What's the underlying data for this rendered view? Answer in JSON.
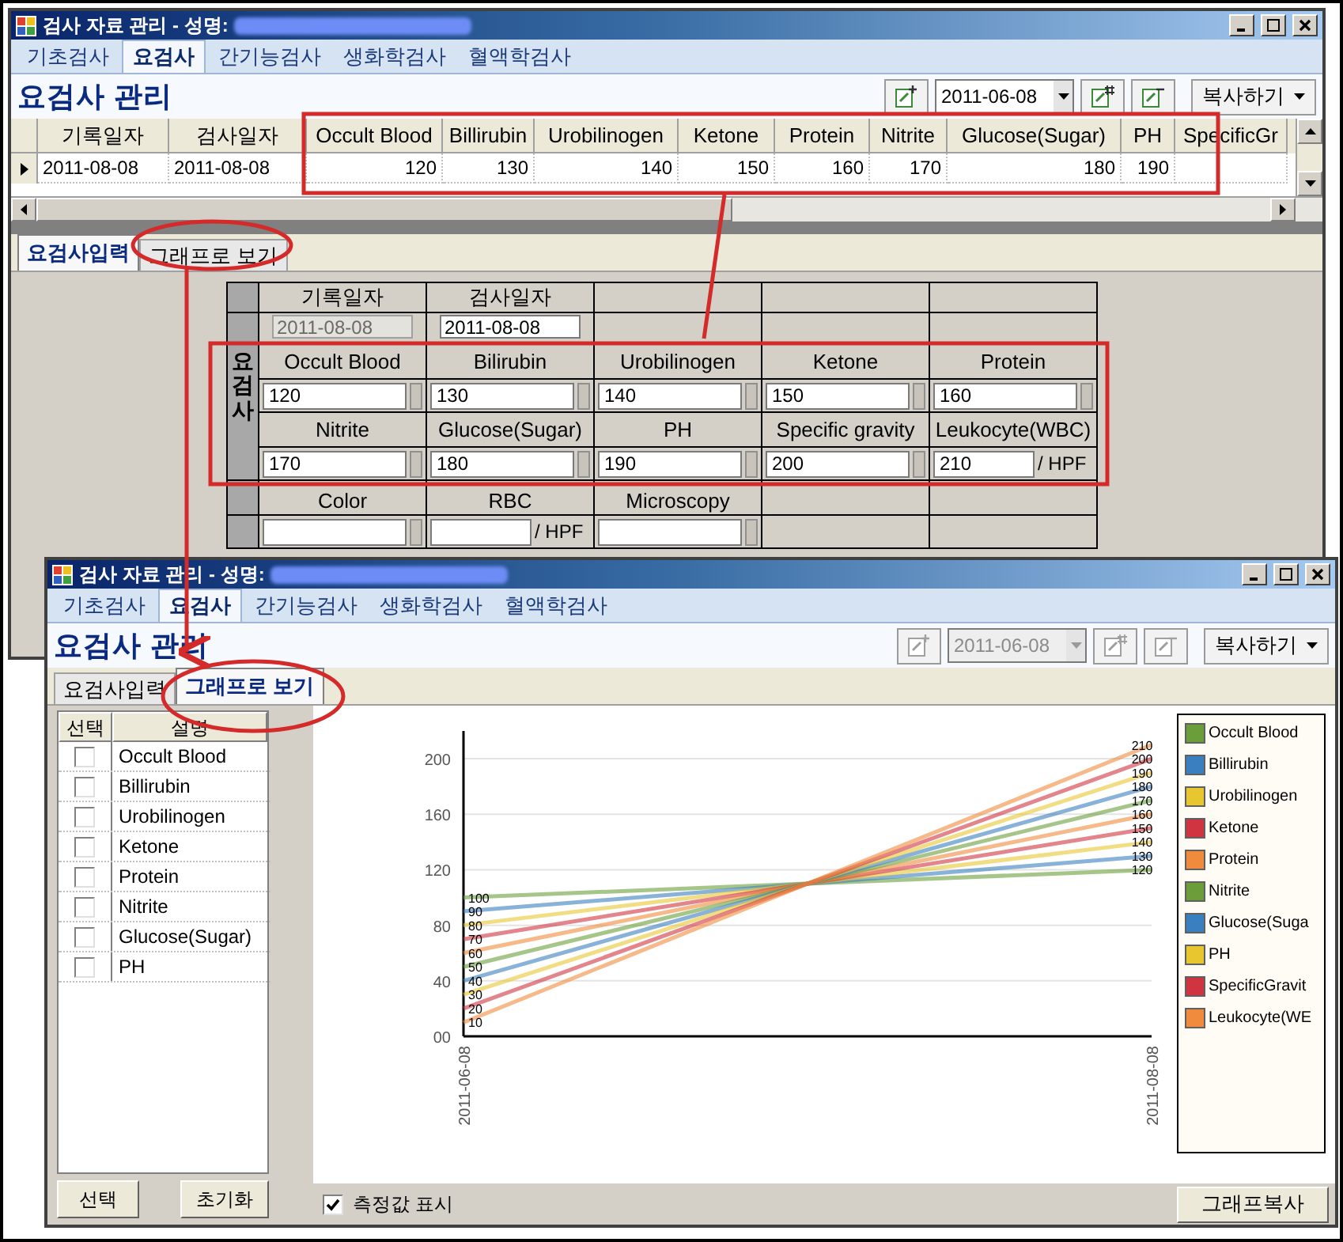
{
  "windows": [
    {
      "title": "검사 자료 관리 - 성명:",
      "tabs": [
        {
          "label": "기초검사",
          "selected": false
        },
        {
          "label": "요검사",
          "selected": true
        },
        {
          "label": "간기능검사",
          "selected": false
        },
        {
          "label": "생화학검사",
          "selected": false
        },
        {
          "label": "혈액학검사",
          "selected": false
        }
      ],
      "heading": "요검사 관리",
      "toolbar": {
        "date": "2011-06-08",
        "disabled": false,
        "copy_button": "복사하기"
      },
      "grid": {
        "columns": [
          "기록일자",
          "검사일자",
          "Occult Blood",
          "Billirubin",
          "Urobilinogen",
          "Ketone",
          "Protein",
          "Nitrite",
          "Glucose(Sugar)",
          "PH",
          "SpecificGr"
        ],
        "rows": [
          {
            "current": true,
            "cells": [
              "2011-08-08",
              "2011-08-08",
              "120",
              "130",
              "140",
              "150",
              "160",
              "170",
              "180",
              "190"
            ]
          }
        ]
      },
      "subtabs": [
        {
          "label": "요검사입력",
          "selected": true
        },
        {
          "label": "그래프로 보기",
          "selected": false
        }
      ],
      "content": {
        "kind": "input",
        "form": {
          "group_label": "요검사",
          "date_fields": [
            {
              "label": "기록일자",
              "value": "2011-08-08",
              "disabled": true
            },
            {
              "label": "검사일자",
              "value": "2011-08-08",
              "disabled": false
            }
          ],
          "fields": [
            {
              "label": "Occult Blood",
              "value": "120"
            },
            {
              "label": "Bilirubin",
              "value": "130"
            },
            {
              "label": "Urobilinogen",
              "value": "140"
            },
            {
              "label": "Ketone",
              "value": "150"
            },
            {
              "label": "Protein",
              "value": "160"
            },
            {
              "label": "Nitrite",
              "value": "170"
            },
            {
              "label": "Glucose(Sugar)",
              "value": "180"
            },
            {
              "label": "PH",
              "value": "190"
            },
            {
              "label": "Specific gravity",
              "value": "200"
            },
            {
              "label": "Leukocyte(WBC)",
              "value": "210",
              "unit": "/ HPF"
            }
          ],
          "extra_fields": [
            {
              "label": "Color"
            },
            {
              "label": "RBC",
              "unit": "/ HPF"
            },
            {
              "label": "Microscopy"
            }
          ]
        }
      }
    },
    {
      "title": "검사 자료 관리 - 성명:",
      "tabs": [
        {
          "label": "기초검사",
          "selected": false
        },
        {
          "label": "요검사",
          "selected": true
        },
        {
          "label": "간기능검사",
          "selected": false
        },
        {
          "label": "생화학검사",
          "selected": false
        },
        {
          "label": "혈액학검사",
          "selected": false
        }
      ],
      "heading": "요검사 관리",
      "toolbar": {
        "date": "2011-06-08",
        "disabled": true,
        "copy_button": "복사하기"
      },
      "subtabs": [
        {
          "label": "요검사입력",
          "selected": false
        },
        {
          "label": "그래프로 보기",
          "selected": true
        }
      ],
      "content": {
        "kind": "graph",
        "list_columns": [
          "선택",
          "설명"
        ],
        "items": [
          {
            "label": "Occult Blood",
            "checked": false
          },
          {
            "label": "Billirubin",
            "checked": false
          },
          {
            "label": "Urobilinogen",
            "checked": false
          },
          {
            "label": "Ketone",
            "checked": false
          },
          {
            "label": "Protein",
            "checked": false
          },
          {
            "label": "Nitrite",
            "checked": false
          },
          {
            "label": "Glucose(Sugar)",
            "checked": false
          },
          {
            "label": "PH",
            "checked": false
          }
        ],
        "list_buttons": [
          "선택",
          "초기화"
        ],
        "show_values": {
          "label": "측정값 표시",
          "checked": true
        },
        "copy_button": "그래프복사",
        "chart_data": {
          "type": "line",
          "x": [
            "2011-06-08",
            "2011-08-08"
          ],
          "ylim": [
            0,
            220
          ],
          "yticks": [
            {
              "value": 0,
              "label": "00"
            },
            40,
            80,
            120,
            160,
            200
          ],
          "data_labels": true,
          "series": [
            {
              "name": "Occult Blood",
              "color": "#6b9e3a",
              "values": [
                100,
                120
              ]
            },
            {
              "name": "Billirubin",
              "color": "#3a7fc0",
              "values": [
                90,
                130
              ]
            },
            {
              "name": "Urobilinogen",
              "color": "#e8c630",
              "values": [
                80,
                140
              ]
            },
            {
              "name": "Ketone",
              "color": "#d03440",
              "values": [
                70,
                150
              ]
            },
            {
              "name": "Protein",
              "color": "#f08a3c",
              "values": [
                60,
                160
              ]
            },
            {
              "name": "Nitrite",
              "color": "#6b9e3a",
              "values": [
                50,
                170
              ]
            },
            {
              "name": "Glucose(Suga",
              "color": "#3a7fc0",
              "values": [
                40,
                180
              ]
            },
            {
              "name": "PH",
              "color": "#e8c630",
              "values": [
                30,
                190
              ]
            },
            {
              "name": "SpecificGravit",
              "color": "#d03440",
              "values": [
                20,
                200
              ]
            },
            {
              "name": "Leukocyte(WE",
              "color": "#f08a3c",
              "values": [
                10,
                210
              ]
            }
          ]
        }
      }
    }
  ]
}
